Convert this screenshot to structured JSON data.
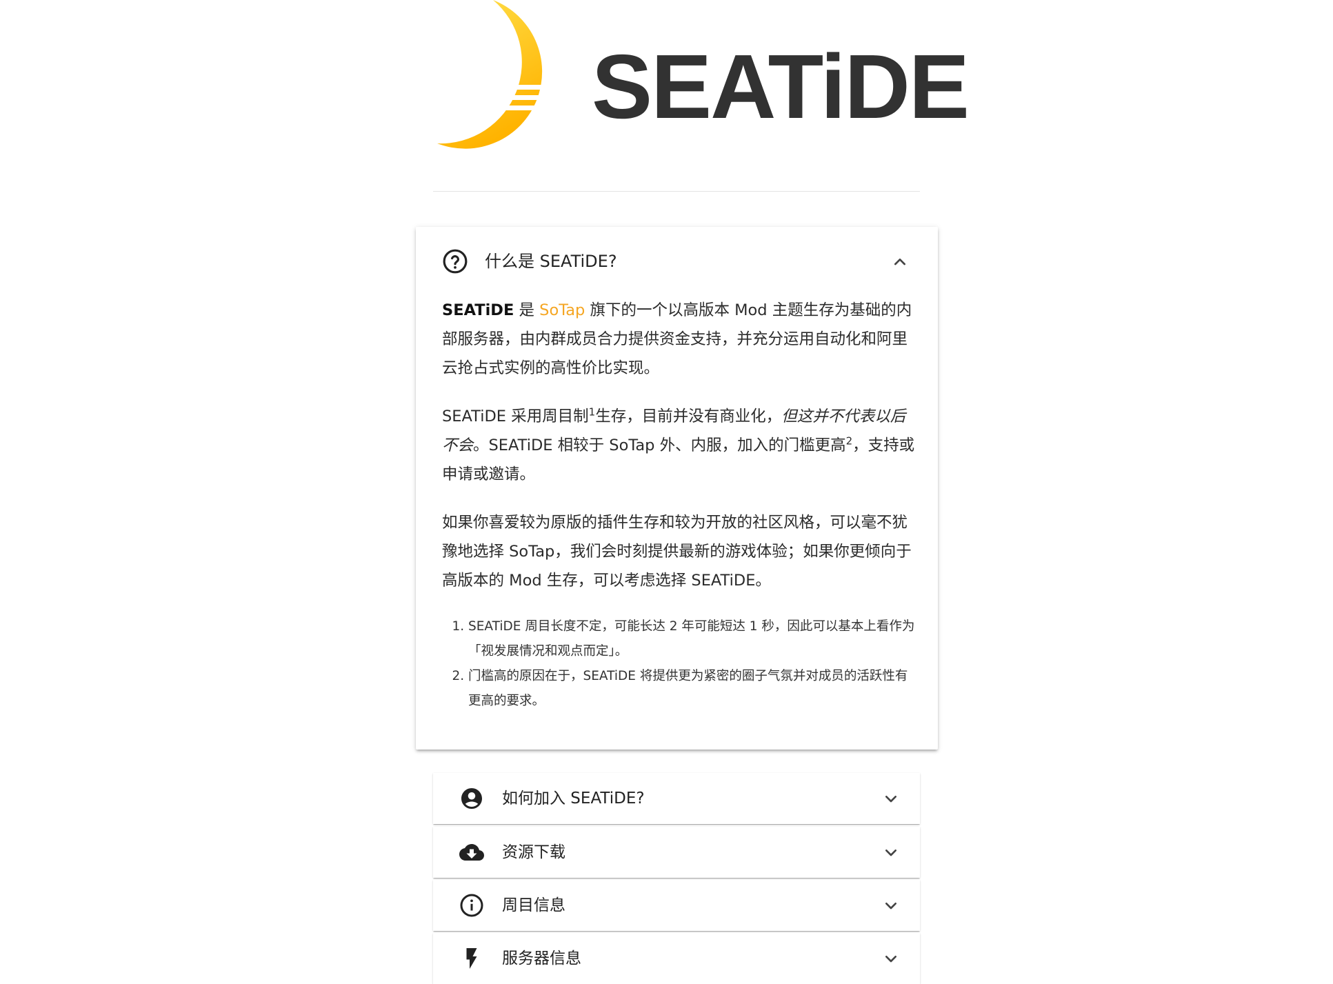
{
  "brand": {
    "name": "SEATiDE",
    "colors": {
      "moon_light": "#ffe14d",
      "moon_dark": "#ffb300",
      "wordmark": "#323232"
    }
  },
  "accent_color": "#f5a623",
  "faq_open": {
    "icon": "help-circle-icon",
    "title": "什么是 SEATiDE?",
    "p1": {
      "strong": "SEATiDE",
      "t1": " 是 ",
      "link": "SoTap",
      "t2": " 旗下的一个以高版本 Mod 主题生存为基础的内部服务器，由内群成员合力提供资金支持，并充分运用自动化和阿里云抢占式实例的高性价比实现。"
    },
    "p2": {
      "t1": "SEATiDE 采用周目制",
      "sup1": "1",
      "t2": "生存，目前并没有商业化，",
      "em": "但这并不代表以后不会",
      "t3": "。SEATiDE 相较于 SoTap 外、内服，加入的门槛更高",
      "sup2": "2",
      "t4": "，支持或申请或邀请。"
    },
    "p3": "如果你喜爱较为原版的插件生存和较为开放的社区风格，可以毫不犹豫地选择 SoTap，我们会时刻提供最新的游戏体验；如果你更倾向于高版本的 Mod 生存，可以考虑选择 SEATiDE。",
    "notes": [
      "SEATiDE 周目长度不定，可能长达 2 年可能短达 1 秒，因此可以基本上看作为「视发展情况和观点而定」。",
      "门槛高的原因在于，SEATiDE 将提供更为紧密的圈子气氛并对成员的活跃性有更高的要求。"
    ]
  },
  "faq_closed": [
    {
      "icon": "account-circle-icon",
      "title": "如何加入 SEATiDE?"
    },
    {
      "icon": "cloud-download-icon",
      "title": "资源下载"
    },
    {
      "icon": "info-circle-icon",
      "title": "周目信息"
    },
    {
      "icon": "flash-icon",
      "title": "服务器信息"
    }
  ]
}
